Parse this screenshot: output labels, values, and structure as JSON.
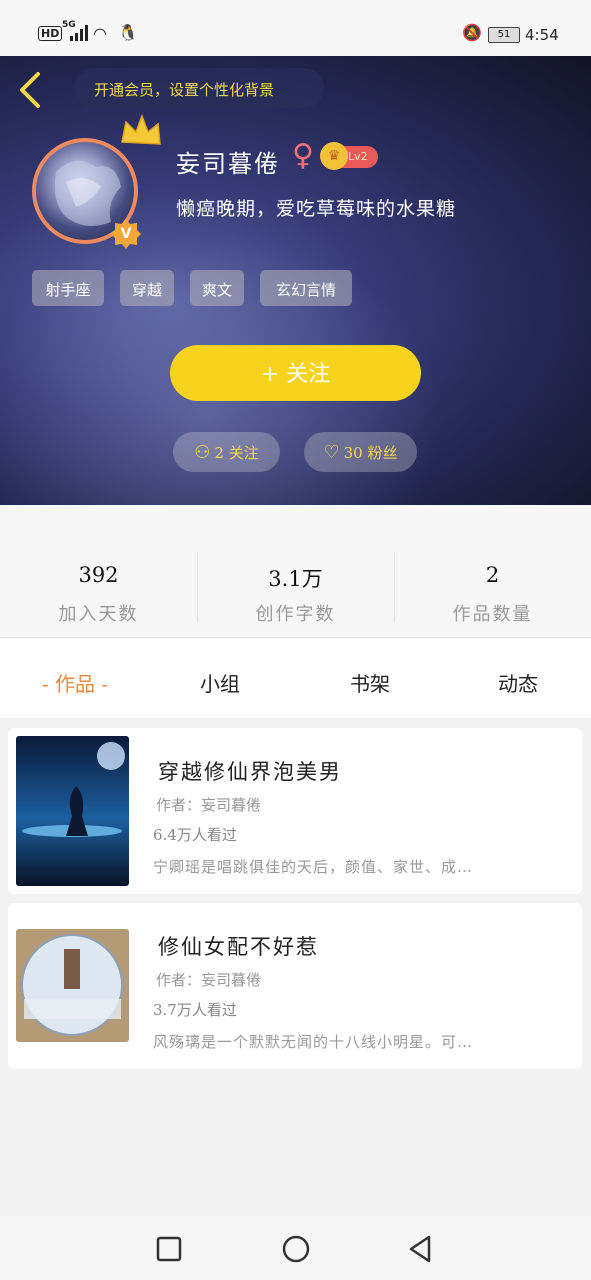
{
  "status_bar": {
    "hd": "HD",
    "network": "5G",
    "battery": "51",
    "time": "4:54"
  },
  "header": {
    "vip_banner": "开通会员，设置个性化背景",
    "username": "妄司暮倦",
    "gender_symbol": "♀",
    "level": "Lv2",
    "bio": "懒癌晚期，爱吃草莓味的水果糖",
    "tags": [
      "射手座",
      "穿越",
      "爽文",
      "玄幻言情"
    ],
    "follow_button": "+   关注",
    "following": "2 关注",
    "followers": "30 粉丝",
    "accent_color": "#f7d31e"
  },
  "stats": [
    {
      "value": "392",
      "label": "加入天数"
    },
    {
      "value": "3.1万",
      "label": "创作字数"
    },
    {
      "value": "2",
      "label": "作品数量"
    }
  ],
  "tabs": [
    {
      "label": "- 作品 -",
      "active": true
    },
    {
      "label": "小组",
      "active": false
    },
    {
      "label": "书架",
      "active": false
    },
    {
      "label": "动态",
      "active": false
    }
  ],
  "works": [
    {
      "title": "穿越修仙界泡美男",
      "author": "作者：妄司暮倦",
      "views": "6.4万人看过",
      "desc": "宁卿瑶是唱跳俱佳的天后，颜值、家世、成…"
    },
    {
      "title": "修仙女配不好惹",
      "author": "作者：妄司暮倦",
      "views": "3.7万人看过",
      "desc": "风殇璃是一个默默无闻的十八线小明星。可…"
    }
  ]
}
